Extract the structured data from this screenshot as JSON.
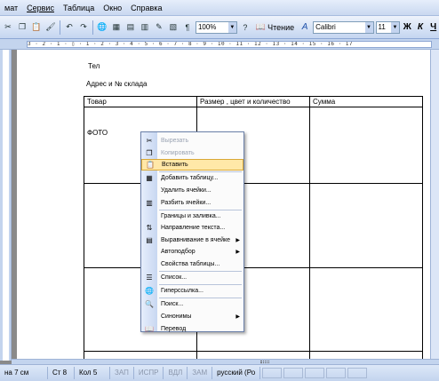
{
  "menubar": {
    "items": [
      "мат",
      "Сервис",
      "Таблица",
      "Окно",
      "Справка"
    ]
  },
  "toolbar": {
    "zoom": "100%",
    "read_label": "Чтение",
    "font_name": "Calibri",
    "font_size": "11",
    "bold": "Ж",
    "italic": "К",
    "underline": "Ч"
  },
  "ruler": {
    "text": "3 · 2 · 1 · ▯ · 1 · 2 · 3 · 4 · 5 · 6 · 7 · 8 · 9 · 10 · 11 · 12 · 13 · 14 · 15 · 16 · 17"
  },
  "document": {
    "line1": "Тел",
    "line2": "Адрес и № склада",
    "table_headers": [
      "Товар",
      "Размер , цвет и количество",
      "Сумма"
    ],
    "photo_label": "ФОТО"
  },
  "context_menu": {
    "items": [
      {
        "label": "Вырезать",
        "icon": "scissors-icon",
        "glyph": "✂",
        "disabled": true
      },
      {
        "label": "Копировать",
        "icon": "copy-icon",
        "glyph": "❐",
        "disabled": true
      },
      {
        "label": "Вставить",
        "icon": "paste-icon",
        "glyph": "📋",
        "highlighted": true
      },
      {
        "label": "Добавить таблицу...",
        "icon": "insert-table-icon",
        "glyph": "▦"
      },
      {
        "label": "Удалить ячейки...",
        "icon": "",
        "glyph": ""
      },
      {
        "label": "Разбить ячейки...",
        "icon": "split-cells-icon",
        "glyph": "▥"
      },
      {
        "label": "Границы и заливка...",
        "icon": "",
        "glyph": ""
      },
      {
        "label": "Направление текста...",
        "icon": "text-direction-icon",
        "glyph": "⇅"
      },
      {
        "label": "Выравнивание в ячейке",
        "icon": "cell-align-icon",
        "glyph": "▤",
        "submenu": true
      },
      {
        "label": "Автоподбор",
        "icon": "",
        "glyph": "",
        "submenu": true
      },
      {
        "label": "Свойства таблицы...",
        "icon": "",
        "glyph": ""
      },
      {
        "label": "Список...",
        "icon": "list-icon",
        "glyph": "☰"
      },
      {
        "label": "Гиперссылка...",
        "icon": "hyperlink-icon",
        "glyph": "🌐"
      },
      {
        "label": "Поиск...",
        "icon": "search-icon",
        "glyph": "🔍"
      },
      {
        "label": "Синонимы",
        "icon": "",
        "glyph": "",
        "submenu": true
      },
      {
        "label": "Перевод",
        "icon": "translate-icon",
        "glyph": "📖"
      }
    ],
    "submenu_arrow": "▶"
  },
  "statusbar": {
    "pos": "на 7 см",
    "line": "Ст 8",
    "col": "Кол 5",
    "rec": "ЗАП",
    "trk": "ИСПР",
    "ext": "ВДЛ",
    "ovr": "ЗАМ",
    "lang": "русский (Ро"
  }
}
